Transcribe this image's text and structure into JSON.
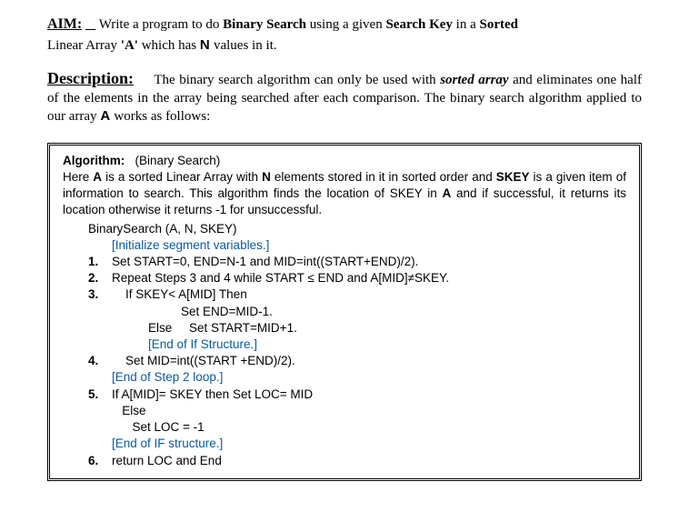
{
  "aim": {
    "label": "AIM:",
    "text_pre": "Write a program to do ",
    "bold1": "Binary  Search",
    "text_mid1": "  using  a given ",
    "bold2": "Search Key",
    "text_mid2": "  in a ",
    "bold3": "Sorted",
    "line2_pre": "Linear Array ",
    "aq": "'A'",
    "line2_mid": "  which has ",
    "nword": "N",
    "line2_end": " values in it."
  },
  "desc": {
    "label": "Description:",
    "p1_a": "The binary search algorithm can only be used with ",
    "p1_sorted": "sorted array",
    "p1_b": "and eliminates one half of the elements in the array being searched after each comparison. The binary search algorithm applied to our array ",
    "p1_A": "A",
    "p1_c": " works as follows:"
  },
  "algo": {
    "title_label": "Algorithm:",
    "title_rest": "(Binary Search)",
    "intro_a": " Here   ",
    "intro_A": "A",
    "intro_b": "   is a sorted Linear Array with ",
    "intro_N": "N",
    "intro_c": " elements stored in it in sorted order and ",
    "intro_SKEY": "SKEY",
    "intro_d": " is a given item of information to search. This algorithm finds the location of SKEY in  ",
    "intro_A2": "A",
    "intro_e": " and if successful, it returns its location otherwise it returns -1 for unsuccessful.",
    "fn": "BinarySearch (A, N, SKEY)",
    "c1": "[Initialize segment variables.]",
    "s1": "Set START=0, END=N-1 and MID=int((START+END)/2).",
    "s2": "Repeat Steps 3 and 4 while START ≤ END and A[MID]≠SKEY.",
    "s3a": "If SKEY< A[MID] Then",
    "s3b": "Set END=MID-1.",
    "s3c_else": "Else",
    "s3c_set": "Set START=MID+1.",
    "c2": "[End of If Structure.]",
    "s4": "Set MID=int((START +END)/2).",
    "c3": "[End of Step 2 loop.]",
    "s5a": "If  A[MID]= SKEY then   Set LOC= MID",
    "s5b": "Else",
    "s5c": "Set LOC = -1",
    "c4": "[End of IF structure.]",
    "s6": "return LOC and End",
    "n1": "1.",
    "n2": "2.",
    "n3": "3.",
    "n4": "4.",
    "n5": "5.",
    "n6": "6."
  }
}
